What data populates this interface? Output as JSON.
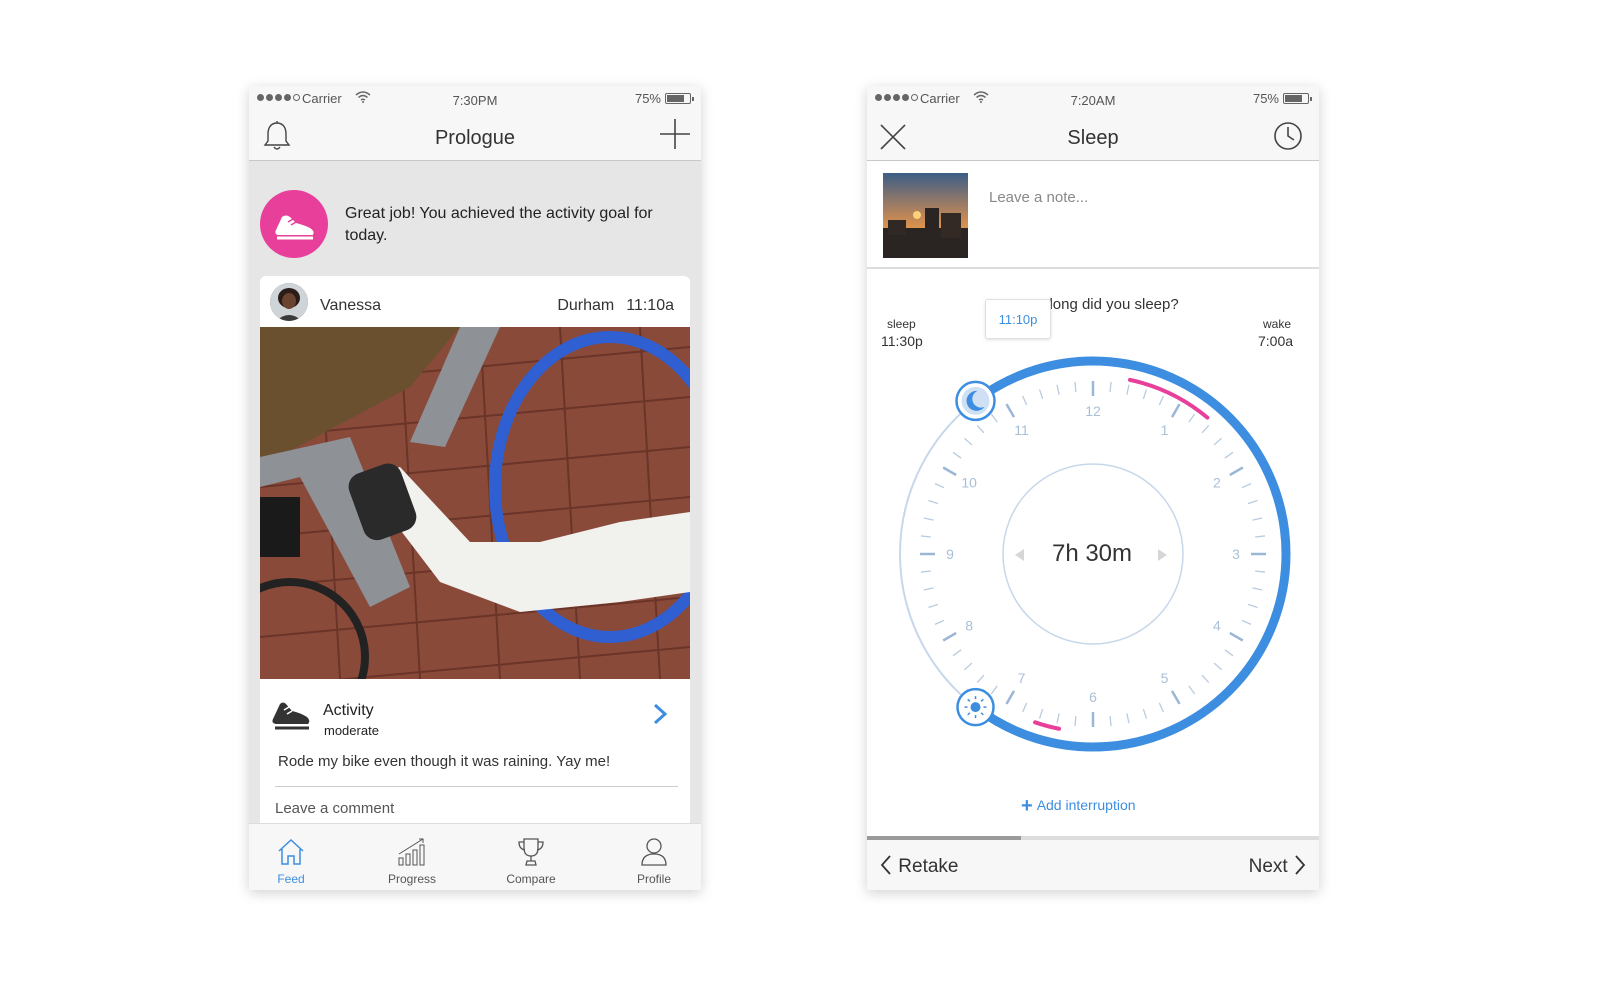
{
  "left_screen": {
    "status": {
      "carrier": "Carrier",
      "time": "7:30PM",
      "battery": "75%"
    },
    "nav": {
      "title": "Prologue",
      "left_icon": "bell-icon",
      "right_icon": "plus-icon"
    },
    "goal_banner": {
      "text": "Great job! You achieved the activity goal for today.",
      "icon": "shoe-icon",
      "color": "#e8409a"
    },
    "post": {
      "user": "Vanessa",
      "location": "Durham",
      "time": "11:10a",
      "activity_title": "Activity",
      "activity_level": "moderate",
      "text": "Rode my bike even though it was raining. Yay me!",
      "comment_placeholder": "Leave a comment"
    },
    "tabs": [
      {
        "label": "Feed",
        "icon": "home-icon",
        "active": true
      },
      {
        "label": "Progress",
        "icon": "bar-chart-icon",
        "active": false
      },
      {
        "label": "Compare",
        "icon": "trophy-icon",
        "active": false
      },
      {
        "label": "Profile",
        "icon": "person-icon",
        "active": false
      }
    ]
  },
  "right_screen": {
    "status": {
      "carrier": "Carrier",
      "time": "7:20AM",
      "battery": "75%"
    },
    "nav": {
      "title": "Sleep",
      "left_icon": "close-icon",
      "right_icon": "clock-icon"
    },
    "note_placeholder": "Leave a note...",
    "question": "How long did you sleep?",
    "sleep_label": "sleep",
    "sleep_time": "11:30p",
    "wake_label": "wake",
    "wake_time": "7:00a",
    "tooltip": "11:10p",
    "duration": "7h 30m",
    "clock_numbers": [
      "12",
      "1",
      "2",
      "3",
      "4",
      "5",
      "6",
      "7",
      "8",
      "9",
      "10",
      "11"
    ],
    "add_interruption": "Add interruption",
    "progress": 0.34,
    "back_button": "Retake",
    "next_button": "Next",
    "accent": "#3d8ee0",
    "interruption_color": "#e8409a"
  }
}
